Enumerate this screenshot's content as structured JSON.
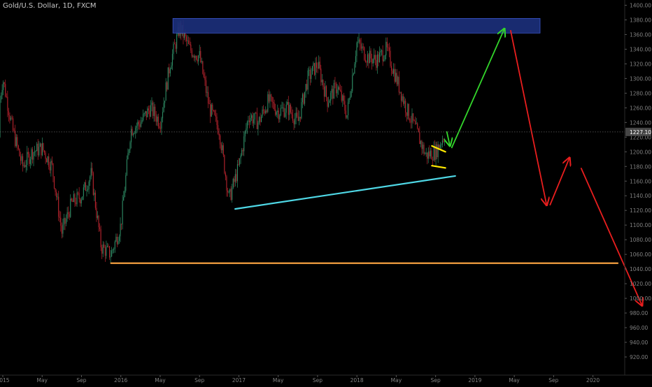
{
  "header": {
    "title": "Gold/U.S. Dollar, 1D, FXCM"
  },
  "chart_data": {
    "type": "candlestick",
    "title": "Gold/U.S. Dollar, 1D, FXCM",
    "ylim": [
      910,
      1405
    ],
    "y_ticks": [
      920,
      940,
      960,
      980,
      1000,
      1020,
      1040,
      1060,
      1080,
      1100,
      1120,
      1140,
      1160,
      1180,
      1200,
      1220,
      1240,
      1260,
      1280,
      1300,
      1320,
      1340,
      1360,
      1380,
      1400
    ],
    "y_tick_labels": [
      "920.00",
      "940.00",
      "960.00",
      "980.00",
      "1000.00",
      "1020.00",
      "1040.00",
      "1060.00",
      "1080.00",
      "1100.00",
      "1120.00",
      "1140.00",
      "1160.00",
      "1180.00",
      "1200.00",
      "1220.00",
      "1240.00",
      "1260.00",
      "1280.00",
      "1300.00",
      "1320.00",
      "1340.00",
      "1360.00",
      "1380.00",
      "1400.00"
    ],
    "x_ticks": [
      {
        "label": "2015",
        "date": "2015-01"
      },
      {
        "label": "May",
        "date": "2015-05"
      },
      {
        "label": "Sep",
        "date": "2015-09"
      },
      {
        "label": "2016",
        "date": "2016-01"
      },
      {
        "label": "May",
        "date": "2016-05"
      },
      {
        "label": "Sep",
        "date": "2016-09"
      },
      {
        "label": "2017",
        "date": "2017-01"
      },
      {
        "label": "May",
        "date": "2017-05"
      },
      {
        "label": "Sep",
        "date": "2017-09"
      },
      {
        "label": "2018",
        "date": "2018-01"
      },
      {
        "label": "May",
        "date": "2018-05"
      },
      {
        "label": "Sep",
        "date": "2018-09"
      },
      {
        "label": "2019",
        "date": "2019-01"
      },
      {
        "label": "May",
        "date": "2019-05"
      },
      {
        "label": "Sep",
        "date": "2019-09"
      },
      {
        "label": "2020",
        "date": "2020-01"
      }
    ],
    "last_price": 1227.1,
    "last_price_label": "1227.10",
    "price_path": [
      [
        "2014-10",
        1220
      ],
      [
        "2014-11",
        1180
      ],
      [
        "2014-12",
        1200
      ],
      [
        "2015-01",
        1300
      ],
      [
        "2015-02",
        1230
      ],
      [
        "2015-03",
        1180
      ],
      [
        "2015-04",
        1200
      ],
      [
        "2015-05",
        1205
      ],
      [
        "2015-06",
        1180
      ],
      [
        "2015-07",
        1090
      ],
      [
        "2015-08",
        1130
      ],
      [
        "2015-09",
        1140
      ],
      [
        "2015-10",
        1170
      ],
      [
        "2015-11",
        1070
      ],
      [
        "2015-12",
        1060
      ],
      [
        "2016-01",
        1100
      ],
      [
        "2016-02",
        1230
      ],
      [
        "2016-03",
        1240
      ],
      [
        "2016-04",
        1260
      ],
      [
        "2016-05",
        1240
      ],
      [
        "2016-06",
        1320
      ],
      [
        "2016-07",
        1370
      ],
      [
        "2016-08",
        1340
      ],
      [
        "2016-09",
        1330
      ],
      [
        "2016-10",
        1260
      ],
      [
        "2016-11",
        1230
      ],
      [
        "2016-12",
        1135
      ],
      [
        "2017-01",
        1180
      ],
      [
        "2017-02",
        1250
      ],
      [
        "2017-03",
        1240
      ],
      [
        "2017-04",
        1270
      ],
      [
        "2017-05",
        1255
      ],
      [
        "2017-06",
        1260
      ],
      [
        "2017-07",
        1240
      ],
      [
        "2017-08",
        1300
      ],
      [
        "2017-09",
        1320
      ],
      [
        "2017-10",
        1270
      ],
      [
        "2017-11",
        1290
      ],
      [
        "2017-12",
        1250
      ],
      [
        "2018-01",
        1350
      ],
      [
        "2018-02",
        1330
      ],
      [
        "2018-03",
        1325
      ],
      [
        "2018-04",
        1340
      ],
      [
        "2018-05",
        1300
      ],
      [
        "2018-06",
        1260
      ],
      [
        "2018-07",
        1230
      ],
      [
        "2018-08",
        1195
      ],
      [
        "2018-09",
        1200
      ],
      [
        "2018-10",
        1225
      ]
    ],
    "drawings": [
      {
        "type": "rectangle",
        "color": "#1b2f7a",
        "from": [
          "2016-06-10",
          1362
        ],
        "to": [
          "2019-07-20",
          1382
        ]
      },
      {
        "type": "line",
        "color": "#4fd8e6",
        "from": [
          "2016-12-20",
          1122
        ],
        "to": [
          "2018-11-01",
          1167
        ]
      },
      {
        "type": "line",
        "color": "#f5a040",
        "from": [
          "2015-12-01",
          1048
        ],
        "to": [
          "2020-06-15",
          1048
        ]
      },
      {
        "type": "line",
        "color": "#ffe800",
        "from": [
          "2018-08-20",
          1208
        ],
        "to": [
          "2018-10-01",
          1200
        ]
      },
      {
        "type": "line",
        "color": "#ffe800",
        "from": [
          "2018-08-20",
          1181
        ],
        "to": [
          "2018-10-01",
          1178
        ]
      },
      {
        "type": "arrow",
        "color": "#33d62b",
        "from": [
          "2018-10-05",
          1228
        ],
        "to": [
          "2018-10-15",
          1208
        ]
      },
      {
        "type": "arrow",
        "color": "#33d62b",
        "from": [
          "2018-10-20",
          1205
        ],
        "to": [
          "2019-04-01",
          1368
        ]
      },
      {
        "type": "arrow",
        "color": "#e81e1e",
        "from": [
          "2019-04-20",
          1366
        ],
        "to": [
          "2019-08-10",
          1127
        ]
      },
      {
        "type": "arrow",
        "color": "#e81e1e",
        "from": [
          "2019-08-20",
          1127
        ],
        "to": [
          "2019-10-20",
          1192
        ]
      },
      {
        "type": "arrow",
        "color": "#e81e1e",
        "from": [
          "2019-11-25",
          1178
        ],
        "to": [
          "2020-06-01",
          990
        ]
      }
    ],
    "colors": {
      "background": "#000000",
      "up_candle": "#2e8b64",
      "down_candle": "#b8242e",
      "axis_text": "#808080",
      "last_price_badge": "#464646",
      "last_price_line": "#606060"
    },
    "grid": false
  }
}
